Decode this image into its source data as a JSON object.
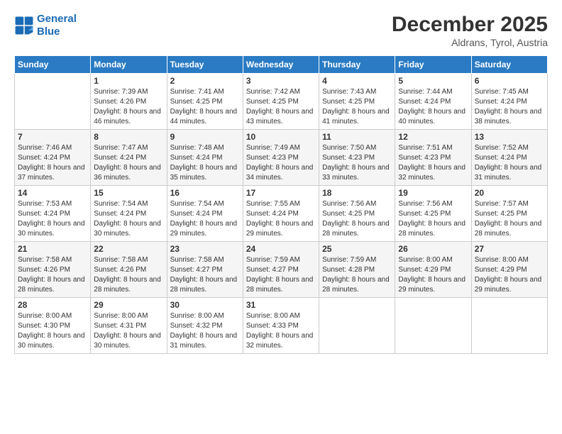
{
  "header": {
    "logo_line1": "General",
    "logo_line2": "Blue",
    "month_title": "December 2025",
    "location": "Aldrans, Tyrol, Austria"
  },
  "days_of_week": [
    "Sunday",
    "Monday",
    "Tuesday",
    "Wednesday",
    "Thursday",
    "Friday",
    "Saturday"
  ],
  "weeks": [
    [
      {
        "day": "",
        "sunrise": "",
        "sunset": "",
        "daylight": ""
      },
      {
        "day": "1",
        "sunrise": "7:39 AM",
        "sunset": "4:26 PM",
        "daylight": "8 hours and 46 minutes."
      },
      {
        "day": "2",
        "sunrise": "7:41 AM",
        "sunset": "4:25 PM",
        "daylight": "8 hours and 44 minutes."
      },
      {
        "day": "3",
        "sunrise": "7:42 AM",
        "sunset": "4:25 PM",
        "daylight": "8 hours and 43 minutes."
      },
      {
        "day": "4",
        "sunrise": "7:43 AM",
        "sunset": "4:25 PM",
        "daylight": "8 hours and 41 minutes."
      },
      {
        "day": "5",
        "sunrise": "7:44 AM",
        "sunset": "4:24 PM",
        "daylight": "8 hours and 40 minutes."
      },
      {
        "day": "6",
        "sunrise": "7:45 AM",
        "sunset": "4:24 PM",
        "daylight": "8 hours and 38 minutes."
      }
    ],
    [
      {
        "day": "7",
        "sunrise": "7:46 AM",
        "sunset": "4:24 PM",
        "daylight": "8 hours and 37 minutes."
      },
      {
        "day": "8",
        "sunrise": "7:47 AM",
        "sunset": "4:24 PM",
        "daylight": "8 hours and 36 minutes."
      },
      {
        "day": "9",
        "sunrise": "7:48 AM",
        "sunset": "4:24 PM",
        "daylight": "8 hours and 35 minutes."
      },
      {
        "day": "10",
        "sunrise": "7:49 AM",
        "sunset": "4:23 PM",
        "daylight": "8 hours and 34 minutes."
      },
      {
        "day": "11",
        "sunrise": "7:50 AM",
        "sunset": "4:23 PM",
        "daylight": "8 hours and 33 minutes."
      },
      {
        "day": "12",
        "sunrise": "7:51 AM",
        "sunset": "4:23 PM",
        "daylight": "8 hours and 32 minutes."
      },
      {
        "day": "13",
        "sunrise": "7:52 AM",
        "sunset": "4:24 PM",
        "daylight": "8 hours and 31 minutes."
      }
    ],
    [
      {
        "day": "14",
        "sunrise": "7:53 AM",
        "sunset": "4:24 PM",
        "daylight": "8 hours and 30 minutes."
      },
      {
        "day": "15",
        "sunrise": "7:54 AM",
        "sunset": "4:24 PM",
        "daylight": "8 hours and 30 minutes."
      },
      {
        "day": "16",
        "sunrise": "7:54 AM",
        "sunset": "4:24 PM",
        "daylight": "8 hours and 29 minutes."
      },
      {
        "day": "17",
        "sunrise": "7:55 AM",
        "sunset": "4:24 PM",
        "daylight": "8 hours and 29 minutes."
      },
      {
        "day": "18",
        "sunrise": "7:56 AM",
        "sunset": "4:25 PM",
        "daylight": "8 hours and 28 minutes."
      },
      {
        "day": "19",
        "sunrise": "7:56 AM",
        "sunset": "4:25 PM",
        "daylight": "8 hours and 28 minutes."
      },
      {
        "day": "20",
        "sunrise": "7:57 AM",
        "sunset": "4:25 PM",
        "daylight": "8 hours and 28 minutes."
      }
    ],
    [
      {
        "day": "21",
        "sunrise": "7:58 AM",
        "sunset": "4:26 PM",
        "daylight": "8 hours and 28 minutes."
      },
      {
        "day": "22",
        "sunrise": "7:58 AM",
        "sunset": "4:26 PM",
        "daylight": "8 hours and 28 minutes."
      },
      {
        "day": "23",
        "sunrise": "7:58 AM",
        "sunset": "4:27 PM",
        "daylight": "8 hours and 28 minutes."
      },
      {
        "day": "24",
        "sunrise": "7:59 AM",
        "sunset": "4:27 PM",
        "daylight": "8 hours and 28 minutes."
      },
      {
        "day": "25",
        "sunrise": "7:59 AM",
        "sunset": "4:28 PM",
        "daylight": "8 hours and 28 minutes."
      },
      {
        "day": "26",
        "sunrise": "8:00 AM",
        "sunset": "4:29 PM",
        "daylight": "8 hours and 29 minutes."
      },
      {
        "day": "27",
        "sunrise": "8:00 AM",
        "sunset": "4:29 PM",
        "daylight": "8 hours and 29 minutes."
      }
    ],
    [
      {
        "day": "28",
        "sunrise": "8:00 AM",
        "sunset": "4:30 PM",
        "daylight": "8 hours and 30 minutes."
      },
      {
        "day": "29",
        "sunrise": "8:00 AM",
        "sunset": "4:31 PM",
        "daylight": "8 hours and 30 minutes."
      },
      {
        "day": "30",
        "sunrise": "8:00 AM",
        "sunset": "4:32 PM",
        "daylight": "8 hours and 31 minutes."
      },
      {
        "day": "31",
        "sunrise": "8:00 AM",
        "sunset": "4:33 PM",
        "daylight": "8 hours and 32 minutes."
      },
      {
        "day": "",
        "sunrise": "",
        "sunset": "",
        "daylight": ""
      },
      {
        "day": "",
        "sunrise": "",
        "sunset": "",
        "daylight": ""
      },
      {
        "day": "",
        "sunrise": "",
        "sunset": "",
        "daylight": ""
      }
    ]
  ]
}
